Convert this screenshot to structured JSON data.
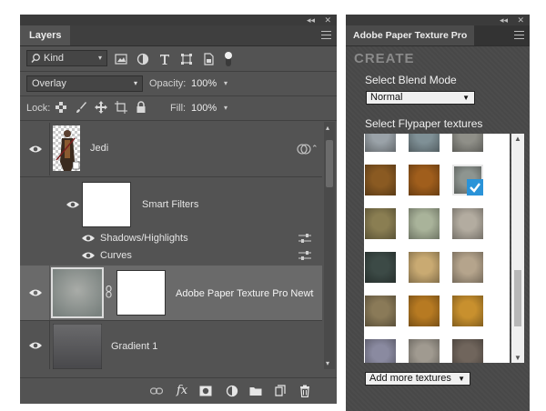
{
  "layers_panel": {
    "collapse_glyph": "◂◂",
    "close_glyph": "✕",
    "tab_label": "Layers",
    "filter": {
      "kind_label": "Kind"
    },
    "blend": {
      "mode": "Overlay",
      "opacity_label": "Opacity:",
      "opacity_value": "100%"
    },
    "lock": {
      "lock_label": "Lock:",
      "fill_label": "Fill:",
      "fill_value": "100%"
    },
    "layers": [
      {
        "name": "Jedi",
        "type": "smart-object"
      },
      {
        "name": "Smart Filters",
        "type": "smart-filters"
      },
      {
        "name": "Shadows/Highlights",
        "type": "filter"
      },
      {
        "name": "Curves",
        "type": "filter"
      },
      {
        "name": "Adobe Paper Texture Pro Newt",
        "type": "texture-with-mask",
        "selected": true
      },
      {
        "name": "Gradient 1",
        "type": "gradient"
      }
    ],
    "bottom_fx": "fx"
  },
  "texture_panel": {
    "tab_label": "Adobe Paper Texture Pro",
    "header": "CREATE",
    "blend_section_title": "Select Blend Mode",
    "blend_mode": "Normal",
    "textures_section_title": "Select Flypaper textures",
    "add_more_label": "Add more textures",
    "selected_texture_index": 5,
    "textures": [
      {
        "name": "texture-1",
        "color": "#9aa2a8"
      },
      {
        "name": "texture-2",
        "color": "#7f9096"
      },
      {
        "name": "texture-3",
        "color": "#8f8f88"
      },
      {
        "name": "texture-4",
        "color": "#8a5a22"
      },
      {
        "name": "texture-5",
        "color": "#a05e1c"
      },
      {
        "name": "texture-6",
        "color": "#8e9590"
      },
      {
        "name": "texture-7",
        "color": "#8a7e52"
      },
      {
        "name": "texture-8",
        "color": "#a9b39a"
      },
      {
        "name": "texture-9",
        "color": "#b3aca0"
      },
      {
        "name": "texture-10",
        "color": "#3c4a46"
      },
      {
        "name": "texture-11",
        "color": "#c9aa72"
      },
      {
        "name": "texture-12",
        "color": "#b5a48c"
      },
      {
        "name": "texture-13",
        "color": "#8a7a58"
      },
      {
        "name": "texture-14",
        "color": "#b77a22"
      },
      {
        "name": "texture-15",
        "color": "#c8902e"
      },
      {
        "name": "texture-16",
        "color": "#8a8aa0"
      },
      {
        "name": "texture-17",
        "color": "#a09a90"
      },
      {
        "name": "texture-18",
        "color": "#70655c"
      }
    ]
  },
  "colors": {
    "panel_bg": "#535353",
    "selected_layer_bg": "#6a6a6a",
    "accent_check": "#2a93d8"
  }
}
